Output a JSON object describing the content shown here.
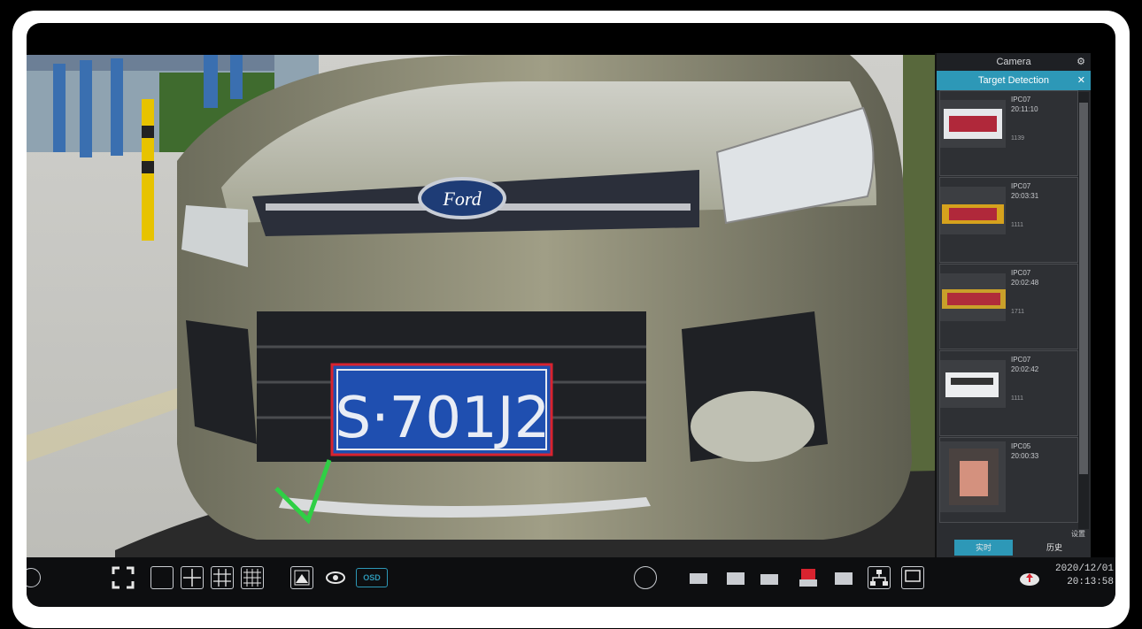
{
  "panel": {
    "header_title": "Camera",
    "settings_icon": "gear-icon",
    "tab_title": "Target Detection",
    "close_icon": "close-icon",
    "detections": [
      {
        "camera": "IPC07",
        "time": "20:11:10",
        "plate": "1139"
      },
      {
        "camera": "IPC07",
        "time": "20:03:31",
        "plate": "1111"
      },
      {
        "camera": "IPC07",
        "time": "20:02:48",
        "plate": "1711"
      },
      {
        "camera": "IPC07",
        "time": "20:02:42",
        "plate": "1111"
      },
      {
        "camera": "IPC05",
        "time": "20:00:33",
        "plate": ""
      }
    ],
    "more_label": "设置",
    "tab_live": "实时",
    "tab_history": "历史"
  },
  "video": {
    "plate_text": "S·701J2",
    "badge_text": "Ford"
  },
  "toolbar": {
    "osd_label": "OSD",
    "date": "2020/12/01",
    "time": "20:13:58",
    "highlight_color": "#2d98b7",
    "check_color": "#2fcf45"
  }
}
